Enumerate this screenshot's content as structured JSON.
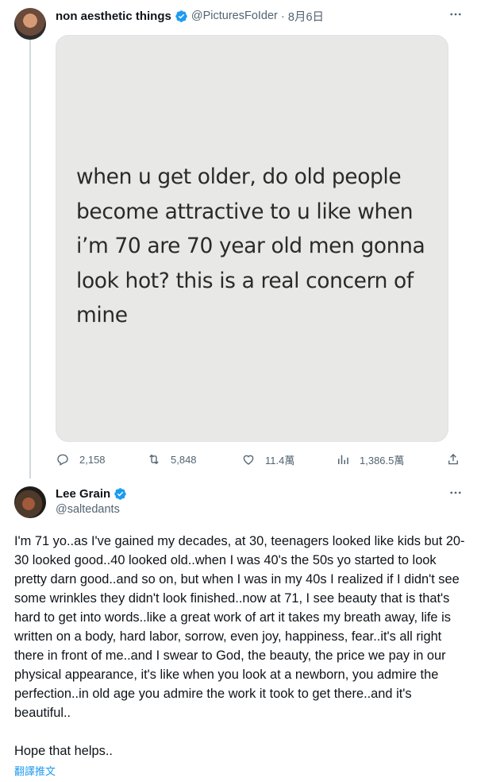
{
  "tweet": {
    "author_name": "non aesthetic things",
    "handle": "@PicturesFoIder",
    "separator": "·",
    "date": "8月6日",
    "image_text": "when u get older, do old people become attractive to u like when i’m 70 are 70 year old men gonna look hot? this is a real concern of mine",
    "stats": {
      "replies": "2,158",
      "retweets": "5,848",
      "likes": "11.4萬",
      "views": "1,386.5萬"
    }
  },
  "reply": {
    "author_name": "Lee Grain",
    "handle": "@saltedants",
    "paragraph1": "I'm 71 yo..as I've gained my decades, at 30, teenagers looked like kids but 20-30 looked good..40 looked old..when I was 40's the 50s yo started to look pretty darn good..and so on, but when I was in my 40s I realized if I didn't see some wrinkles they didn't look finished..now at 71, I see beauty that is that's hard to get into words..like a great work of art it takes my breath away, life is written on a body, hard labor, sorrow, even joy, happiness, fear..it's all right there in front of me..and I swear to God, the beauty, the price we pay in our physical appearance, it's like when you look at a newborn, you admire the perfection..in old age you admire the work it took to get there..and it's beautiful..",
    "paragraph2": "Hope that helps..",
    "translate_link": "翻譯推文"
  },
  "colors": {
    "verified": "#1d9bf0",
    "muted": "#536471",
    "link": "#1d9bf0",
    "text": "#0f1419"
  },
  "icons": [
    "verified-badge-icon",
    "more-icon",
    "reply-icon",
    "retweet-icon",
    "like-icon",
    "views-icon",
    "share-icon"
  ]
}
